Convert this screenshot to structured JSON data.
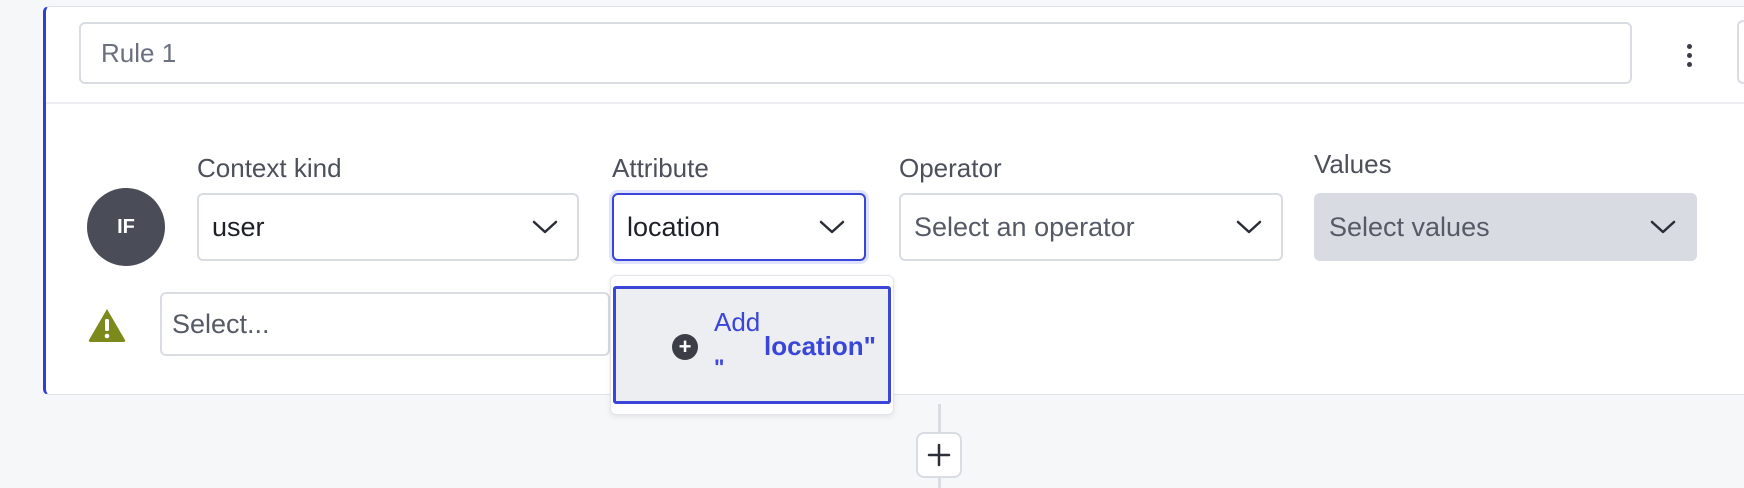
{
  "rule": {
    "name_placeholder": "Rule 1",
    "more_icon": "kebab-vertical-icon"
  },
  "clause": {
    "if_label": "IF",
    "context_kind": {
      "label": "Context kind",
      "value": "user"
    },
    "attribute": {
      "label": "Attribute",
      "value": "location"
    },
    "operator": {
      "label": "Operator",
      "placeholder": "Select an operator"
    },
    "values": {
      "label": "Values",
      "placeholder": "Select values",
      "disabled": true
    },
    "warning_icon": "warning-triangle-icon",
    "secondary_select_placeholder": "Select..."
  },
  "dropdown": {
    "option_prefix": "Add",
    "option_quote": "\"",
    "option_value": "location\""
  },
  "add_rule_icon": "plus-icon",
  "colors": {
    "accent": "#3946d8",
    "warning": "#7c8a1c",
    "badge": "#4a4d57"
  }
}
